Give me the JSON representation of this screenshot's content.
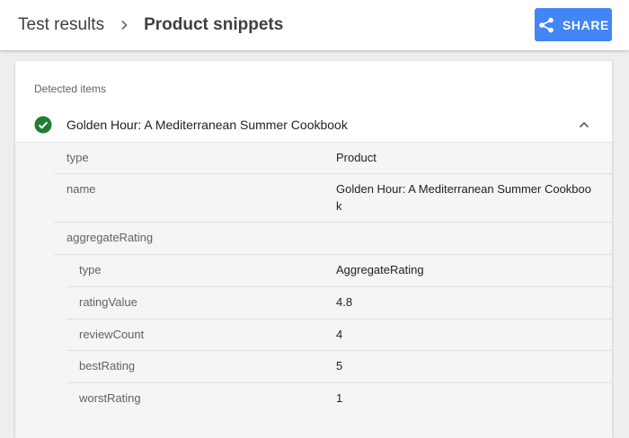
{
  "header": {
    "breadcrumb_root": "Test results",
    "breadcrumb_current": "Product snippets",
    "share_label": "SHARE"
  },
  "card": {
    "section_label": "Detected items",
    "item_title": "Golden Hour: A Mediterranean Summer Cookbook",
    "item_status": "valid"
  },
  "details": [
    {
      "key": "type",
      "value": "Product"
    },
    {
      "key": "name",
      "value": "Golden Hour: A Mediterranean Summer Cookbook"
    },
    {
      "key": "aggregateRating",
      "value": ""
    }
  ],
  "aggregate_rating": [
    {
      "key": "type",
      "value": "AggregateRating"
    },
    {
      "key": "ratingValue",
      "value": "4.8"
    },
    {
      "key": "reviewCount",
      "value": "4"
    },
    {
      "key": "bestRating",
      "value": "5"
    },
    {
      "key": "worstRating",
      "value": "1"
    }
  ],
  "colors": {
    "accent": "#4285f4",
    "success": "#188038"
  }
}
